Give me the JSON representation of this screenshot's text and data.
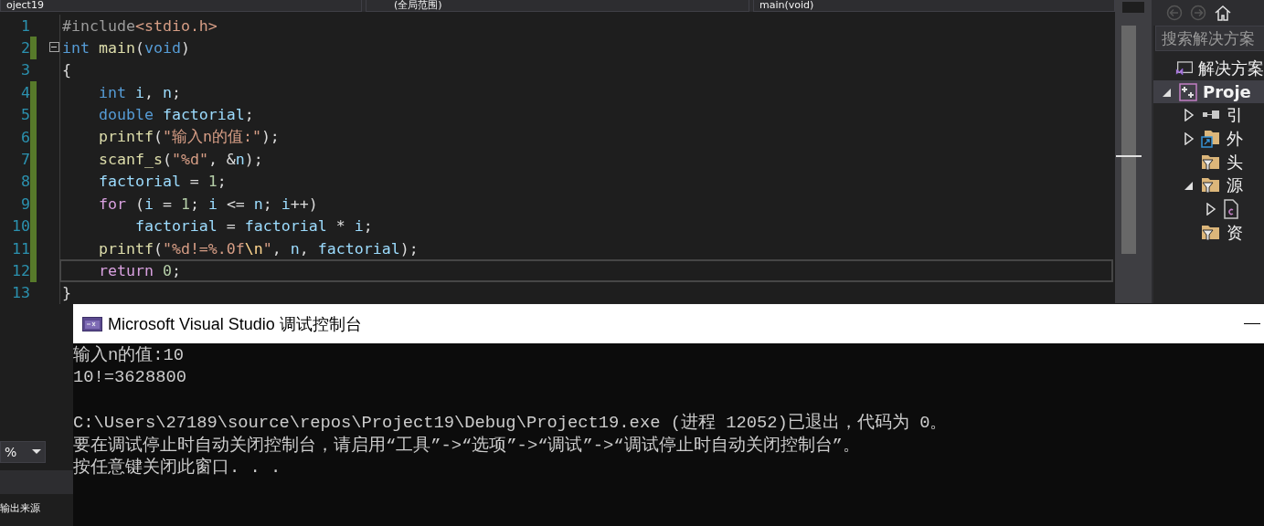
{
  "nav_bar": [
    "oject19",
    "(全局范围)",
    "main(void)"
  ],
  "editor": {
    "lines": [
      {
        "number": "1",
        "changed": false,
        "fold": false,
        "tokens": [
          {
            "kind": "preproc",
            "text": "#include"
          },
          {
            "kind": "string",
            "text": "<stdio.h>"
          }
        ]
      },
      {
        "number": "2",
        "changed": true,
        "fold": true,
        "tokens": [
          {
            "kind": "keyword",
            "text": "int "
          },
          {
            "kind": "func",
            "text": "main"
          },
          {
            "kind": "plain",
            "text": "("
          },
          {
            "kind": "keyword",
            "text": "void"
          },
          {
            "kind": "plain",
            "text": ")"
          }
        ]
      },
      {
        "number": "3",
        "changed": false,
        "fold": false,
        "tokens": [
          {
            "kind": "plain",
            "text": "{"
          }
        ]
      },
      {
        "number": "4",
        "changed": true,
        "fold": false,
        "tokens": [
          {
            "kind": "keyword",
            "text": "    int"
          },
          {
            "kind": "var",
            "text": " i"
          },
          {
            "kind": "plain",
            "text": ", "
          },
          {
            "kind": "var",
            "text": "n"
          },
          {
            "kind": "plain",
            "text": ";"
          }
        ]
      },
      {
        "number": "5",
        "changed": true,
        "fold": false,
        "tokens": [
          {
            "kind": "keyword",
            "text": "    double"
          },
          {
            "kind": "var",
            "text": " factorial"
          },
          {
            "kind": "plain",
            "text": ";"
          }
        ]
      },
      {
        "number": "6",
        "changed": true,
        "fold": false,
        "tokens": [
          {
            "kind": "func",
            "text": "    printf"
          },
          {
            "kind": "plain",
            "text": "("
          },
          {
            "kind": "string",
            "text": "\"输入n的值:\""
          },
          {
            "kind": "plain",
            "text": ");"
          }
        ]
      },
      {
        "number": "7",
        "changed": true,
        "fold": false,
        "tokens": [
          {
            "kind": "func",
            "text": "    scanf_s"
          },
          {
            "kind": "plain",
            "text": "("
          },
          {
            "kind": "string",
            "text": "\"%d\""
          },
          {
            "kind": "plain",
            "text": ", &"
          },
          {
            "kind": "var",
            "text": "n"
          },
          {
            "kind": "plain",
            "text": ");"
          }
        ]
      },
      {
        "number": "8",
        "changed": true,
        "fold": false,
        "tokens": [
          {
            "kind": "var",
            "text": "    factorial"
          },
          {
            "kind": "plain",
            "text": " = "
          },
          {
            "kind": "number",
            "text": "1"
          },
          {
            "kind": "plain",
            "text": ";"
          }
        ]
      },
      {
        "number": "9",
        "changed": true,
        "fold": false,
        "tokens": [
          {
            "kind": "control",
            "text": "    for"
          },
          {
            "kind": "plain",
            "text": " ("
          },
          {
            "kind": "var",
            "text": "i"
          },
          {
            "kind": "plain",
            "text": " = "
          },
          {
            "kind": "number",
            "text": "1"
          },
          {
            "kind": "plain",
            "text": "; "
          },
          {
            "kind": "var",
            "text": "i"
          },
          {
            "kind": "plain",
            "text": " <= "
          },
          {
            "kind": "var",
            "text": "n"
          },
          {
            "kind": "plain",
            "text": "; "
          },
          {
            "kind": "var",
            "text": "i"
          },
          {
            "kind": "plain",
            "text": "++)"
          }
        ]
      },
      {
        "number": "10",
        "changed": true,
        "fold": false,
        "tokens": [
          {
            "kind": "var",
            "text": "        factorial"
          },
          {
            "kind": "plain",
            "text": " = "
          },
          {
            "kind": "var",
            "text": "factorial"
          },
          {
            "kind": "plain",
            "text": " * "
          },
          {
            "kind": "var",
            "text": "i"
          },
          {
            "kind": "plain",
            "text": ";"
          }
        ]
      },
      {
        "number": "11",
        "changed": true,
        "fold": false,
        "tokens": [
          {
            "kind": "func",
            "text": "    printf"
          },
          {
            "kind": "plain",
            "text": "("
          },
          {
            "kind": "string",
            "text": "\"%d!=%.0f"
          },
          {
            "kind": "escape",
            "text": "\\n"
          },
          {
            "kind": "string",
            "text": "\""
          },
          {
            "kind": "plain",
            "text": ", "
          },
          {
            "kind": "var",
            "text": "n"
          },
          {
            "kind": "plain",
            "text": ", "
          },
          {
            "kind": "var",
            "text": "factorial"
          },
          {
            "kind": "plain",
            "text": ");"
          }
        ]
      },
      {
        "number": "12",
        "changed": true,
        "fold": false,
        "current": true,
        "tokens": [
          {
            "kind": "control",
            "text": "    return "
          },
          {
            "kind": "number",
            "text": "0"
          },
          {
            "kind": "plain",
            "text": ";"
          }
        ]
      },
      {
        "number": "13",
        "changed": false,
        "fold": false,
        "tokens": [
          {
            "kind": "plain",
            "text": "}"
          }
        ]
      }
    ]
  },
  "zoom": {
    "value": "%"
  },
  "output_panel": {
    "label": "输出来源"
  },
  "solution_explorer": {
    "search": {
      "placeholder": "搜索解决方案"
    },
    "items": [
      {
        "label": "解决方案",
        "kind": "solution",
        "children": [
          {
            "label": "Proje",
            "kind": "project",
            "expanded": true,
            "selected": true,
            "children": [
              {
                "label": "引",
                "kind": "references",
                "expanded": false
              },
              {
                "label": "外",
                "kind": "external",
                "expanded": false
              },
              {
                "label": "头",
                "kind": "filter"
              },
              {
                "label": "源",
                "kind": "filter",
                "expanded": true,
                "children": [
                  {
                    "kind": "cfile",
                    "expanded": false
                  }
                ]
              },
              {
                "label": "资",
                "kind": "filter"
              }
            ]
          }
        ]
      }
    ]
  },
  "console": {
    "title": "Microsoft Visual Studio 调试控制台",
    "lines": [
      {
        "text": "输入n的值:10",
        "gap_after": false
      },
      {
        "text": "10!=3628800",
        "gap_after": true
      },
      {
        "text": "C:\\Users\\27189\\source\\repos\\Project19\\Debug\\Project19.exe (进程 12052)已退出，代码为 0。",
        "gap_after": false
      },
      {
        "text": "要在调试停止时自动关闭控制台，请启用“工具”->“选项”->“调试”->“调试停止时自动关闭控制台”。",
        "gap_after": false
      },
      {
        "text": "按任意键关闭此窗口. . .",
        "gap_after": false
      }
    ]
  }
}
